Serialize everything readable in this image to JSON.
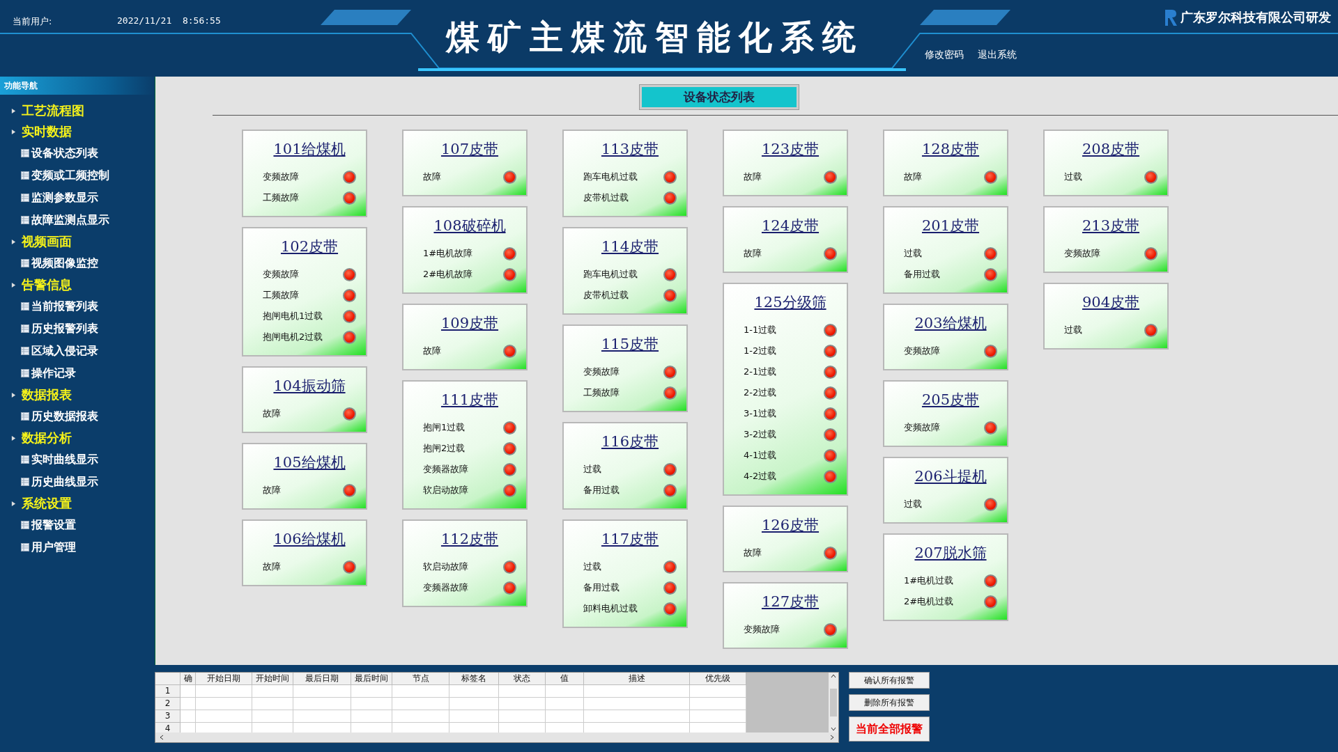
{
  "header": {
    "user_label": "当前用户:",
    "datetime": "2022/11/21  8:56:55",
    "title": "煤矿主煤流智能化系统",
    "company": "广东罗尔科技有限公司研发",
    "links": [
      "修改密码",
      "退出系统"
    ]
  },
  "sidebar": {
    "title": "功能导航",
    "groups": [
      {
        "label": "工艺流程图"
      },
      {
        "label": "实时数据",
        "children": [
          {
            "label": "设备状态列表"
          },
          {
            "label": "变频或工频控制"
          },
          {
            "label": "监测参数显示"
          },
          {
            "label": "故障监测点显示"
          }
        ]
      },
      {
        "label": "视频画面",
        "children": [
          {
            "label": "视频图像监控"
          }
        ]
      },
      {
        "label": "告警信息",
        "children": [
          {
            "label": "当前报警列表"
          },
          {
            "label": "历史报警列表"
          },
          {
            "label": "区域入侵记录"
          },
          {
            "label": "操作记录"
          }
        ]
      },
      {
        "label": "数据报表",
        "children": [
          {
            "label": "历史数据报表"
          }
        ]
      },
      {
        "label": "数据分析",
        "children": [
          {
            "label": "实时曲线显示"
          },
          {
            "label": "历史曲线显示"
          }
        ]
      },
      {
        "label": "系统设置",
        "children": [
          {
            "label": "报警设置"
          },
          {
            "label": "用户管理"
          }
        ]
      }
    ]
  },
  "page_title": "设备状态列表",
  "device_columns": [
    {
      "cards": [
        {
          "name": "101给煤机",
          "signals": [
            {
              "label": "变频故障",
              "alarm": true
            },
            {
              "label": "工频故障",
              "alarm": true
            }
          ]
        },
        {
          "name": "102皮带",
          "signals": [
            {
              "label": "变频故障",
              "alarm": true
            },
            {
              "label": "工频故障",
              "alarm": true
            },
            {
              "label": "抱闸电机1过载",
              "alarm": true
            },
            {
              "label": "抱闸电机2过载",
              "alarm": true
            }
          ]
        },
        {
          "name": "104振动筛",
          "signals": [
            {
              "label": "故障",
              "alarm": true
            }
          ]
        },
        {
          "name": "105给煤机",
          "signals": [
            {
              "label": "故障",
              "alarm": true
            }
          ]
        },
        {
          "name": "106给煤机",
          "signals": [
            {
              "label": "故障",
              "alarm": true
            }
          ]
        }
      ]
    },
    {
      "cards": [
        {
          "name": "107皮带",
          "signals": [
            {
              "label": "故障",
              "alarm": true
            }
          ]
        },
        {
          "name": "108破碎机",
          "signals": [
            {
              "label": "1#电机故障",
              "alarm": true
            },
            {
              "label": "2#电机故障",
              "alarm": true
            }
          ]
        },
        {
          "name": "109皮带",
          "signals": [
            {
              "label": "故障",
              "alarm": true
            }
          ]
        },
        {
          "name": "111皮带",
          "signals": [
            {
              "label": "抱闸1过载",
              "alarm": true
            },
            {
              "label": "抱闸2过载",
              "alarm": true
            },
            {
              "label": "变频器故障",
              "alarm": true
            },
            {
              "label": "软启动故障",
              "alarm": true
            }
          ]
        },
        {
          "name": "112皮带",
          "signals": [
            {
              "label": "软启动故障",
              "alarm": true
            },
            {
              "label": "变频器故障",
              "alarm": true
            }
          ]
        }
      ]
    },
    {
      "cards": [
        {
          "name": "113皮带",
          "signals": [
            {
              "label": "跑车电机过载",
              "alarm": true
            },
            {
              "label": "皮带机过载",
              "alarm": true
            }
          ]
        },
        {
          "name": "114皮带",
          "signals": [
            {
              "label": "跑车电机过载",
              "alarm": true
            },
            {
              "label": "皮带机过载",
              "alarm": true
            }
          ]
        },
        {
          "name": "115皮带",
          "signals": [
            {
              "label": "变频故障",
              "alarm": true
            },
            {
              "label": "工频故障",
              "alarm": true
            }
          ]
        },
        {
          "name": "116皮带",
          "signals": [
            {
              "label": "过载",
              "alarm": true
            },
            {
              "label": "备用过载",
              "alarm": true
            }
          ]
        },
        {
          "name": "117皮带",
          "signals": [
            {
              "label": "过载",
              "alarm": true
            },
            {
              "label": "备用过载",
              "alarm": true
            },
            {
              "label": "卸料电机过载",
              "alarm": true
            }
          ]
        }
      ]
    },
    {
      "cards": [
        {
          "name": "123皮带",
          "signals": [
            {
              "label": "故障",
              "alarm": true
            }
          ]
        },
        {
          "name": "124皮带",
          "signals": [
            {
              "label": "故障",
              "alarm": true
            }
          ]
        },
        {
          "name": "125分级筛",
          "signals": [
            {
              "label": "1-1过载",
              "alarm": true
            },
            {
              "label": "1-2过载",
              "alarm": true
            },
            {
              "label": "2-1过载",
              "alarm": true
            },
            {
              "label": "2-2过载",
              "alarm": true
            },
            {
              "label": "3-1过载",
              "alarm": true
            },
            {
              "label": "3-2过载",
              "alarm": true
            },
            {
              "label": "4-1过载",
              "alarm": true
            },
            {
              "label": "4-2过载",
              "alarm": true
            }
          ]
        },
        {
          "name": "126皮带",
          "signals": [
            {
              "label": "故障",
              "alarm": true
            }
          ]
        },
        {
          "name": "127皮带",
          "signals": [
            {
              "label": "变频故障",
              "alarm": true
            }
          ]
        }
      ]
    },
    {
      "cards": [
        {
          "name": "128皮带",
          "signals": [
            {
              "label": "故障",
              "alarm": true
            }
          ]
        },
        {
          "name": "201皮带",
          "signals": [
            {
              "label": "过载",
              "alarm": true
            },
            {
              "label": "备用过载",
              "alarm": true
            }
          ]
        },
        {
          "name": "203给煤机",
          "signals": [
            {
              "label": "变频故障",
              "alarm": true
            }
          ]
        },
        {
          "name": "205皮带",
          "signals": [
            {
              "label": "变频故障",
              "alarm": true
            }
          ]
        },
        {
          "name": "206斗提机",
          "signals": [
            {
              "label": "过载",
              "alarm": true
            }
          ]
        },
        {
          "name": "207脱水筛",
          "signals": [
            {
              "label": "1#电机过载",
              "alarm": true
            },
            {
              "label": "2#电机过载",
              "alarm": true
            }
          ]
        }
      ]
    },
    {
      "cards": [
        {
          "name": "208皮带",
          "signals": [
            {
              "label": "过载",
              "alarm": true
            }
          ]
        },
        {
          "name": "213皮带",
          "signals": [
            {
              "label": "变频故障",
              "alarm": true
            }
          ]
        },
        {
          "name": "904皮带",
          "signals": [
            {
              "label": "过载",
              "alarm": true
            }
          ]
        }
      ]
    }
  ],
  "alarm_table": {
    "columns": [
      "确",
      "开始日期",
      "开始时间",
      "最后日期",
      "最后时间",
      "节点",
      "标签名",
      "状态",
      "值",
      "描述",
      "优先级"
    ],
    "row_labels": [
      "1",
      "2",
      "3",
      "4"
    ]
  },
  "alarm_buttons": [
    {
      "label": "确认所有报警",
      "kind": "normal"
    },
    {
      "label": "删除所有报警",
      "kind": "normal"
    },
    {
      "label": "当前全部报警",
      "kind": "alert"
    }
  ]
}
